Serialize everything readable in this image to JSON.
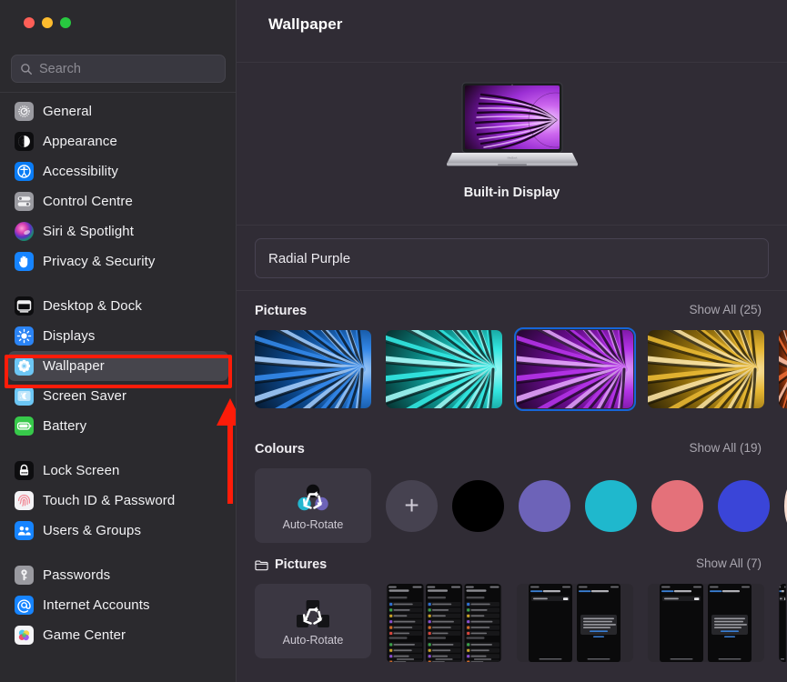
{
  "window": {
    "traffic_lights": [
      {
        "name": "close",
        "color": "#ff5f57"
      },
      {
        "name": "minimise",
        "color": "#febc2e"
      },
      {
        "name": "zoom",
        "color": "#28c840"
      }
    ]
  },
  "search": {
    "placeholder": "Search",
    "value": "",
    "icon": "search-icon"
  },
  "sidebar": {
    "groups": [
      {
        "items": [
          {
            "label": "General",
            "icon": "gear-icon",
            "color": "#8e8e93",
            "selected": false
          },
          {
            "label": "Appearance",
            "icon": "contrast-icon",
            "color": "#1c1c1e",
            "selected": false
          },
          {
            "label": "Accessibility",
            "icon": "accessibility-icon",
            "color": "#0a84ff",
            "selected": false
          },
          {
            "label": "Control Centre",
            "icon": "sliders-icon",
            "color": "#8e8e93",
            "selected": false
          },
          {
            "label": "Siri & Spotlight",
            "icon": "siri-orb-icon",
            "color": "#c44ad0",
            "selected": false
          },
          {
            "label": "Privacy & Security",
            "icon": "hand-icon",
            "color": "#1684ff",
            "selected": false
          }
        ]
      },
      {
        "items": [
          {
            "label": "Desktop & Dock",
            "icon": "desktop-dock-icon",
            "color": "#1c1c1e",
            "selected": false
          },
          {
            "label": "Displays",
            "icon": "brightness-icon",
            "color": "#2b84f5",
            "selected": false
          },
          {
            "label": "Wallpaper",
            "icon": "flower-icon",
            "color": "#6fc7f5",
            "selected": true
          },
          {
            "label": "Screen Saver",
            "icon": "moon-icon",
            "color": "#6fc7f5",
            "selected": false
          },
          {
            "label": "Battery",
            "icon": "battery-icon",
            "color": "#37c94a",
            "selected": false
          }
        ]
      },
      {
        "items": [
          {
            "label": "Lock Screen",
            "icon": "lock-icon",
            "color": "#1c1c1e",
            "selected": false
          },
          {
            "label": "Touch ID & Password",
            "icon": "fingerprint-icon",
            "color": "#f2f2f4",
            "selected": false
          },
          {
            "label": "Users & Groups",
            "icon": "users-icon",
            "color": "#1684ff",
            "selected": false
          }
        ]
      },
      {
        "items": [
          {
            "label": "Passwords",
            "icon": "key-icon",
            "color": "#8e8e93",
            "selected": false
          },
          {
            "label": "Internet Accounts",
            "icon": "at-sign-icon",
            "color": "#1684ff",
            "selected": false
          },
          {
            "label": "Game Center",
            "icon": "game-center-icon",
            "color": "#f5f5f7",
            "selected": false
          }
        ]
      }
    ]
  },
  "main": {
    "title": "Wallpaper",
    "display": {
      "label": "Built-in Display",
      "preview_wallpaper": "Radial Purple"
    },
    "wallpaper_name": {
      "value": "Radial Purple"
    },
    "sections": [
      {
        "id": "pictures",
        "title": "Pictures",
        "has_folder_icon": false,
        "show_all": "Show All (25)",
        "show_all_count": 25,
        "thumbnails": [
          {
            "name": "Radial Blue",
            "hue": 212,
            "selected": false,
            "partial": false
          },
          {
            "name": "Radial Teal",
            "hue": 178,
            "selected": false,
            "partial": false
          },
          {
            "name": "Radial Purple",
            "hue": 283,
            "selected": true,
            "partial": false
          },
          {
            "name": "Radial Yellow",
            "hue": 44,
            "selected": false,
            "partial": false
          },
          {
            "name": "Radial Orange",
            "hue": 18,
            "selected": false,
            "partial": true
          }
        ]
      },
      {
        "id": "colours",
        "title": "Colours",
        "has_folder_icon": false,
        "show_all": "Show All (19)",
        "show_all_count": 19,
        "auto_rotate": {
          "label": "Auto-Rotate",
          "icon": "auto-rotate-icon"
        },
        "swatches": [
          {
            "name": "add-colour",
            "color": "#464250",
            "is_add": true
          },
          {
            "name": "black",
            "color": "#000000",
            "is_add": false
          },
          {
            "name": "purple",
            "color": "#6d63b8",
            "is_add": false
          },
          {
            "name": "cyan",
            "color": "#1fb8cd",
            "is_add": false
          },
          {
            "name": "salmon",
            "color": "#e4717a",
            "is_add": false
          },
          {
            "name": "blue",
            "color": "#3a45d8",
            "is_add": false
          },
          {
            "name": "cream",
            "color": "#f7dcd0",
            "is_add": false
          }
        ]
      },
      {
        "id": "pictures-folder",
        "title": "Pictures",
        "has_folder_icon": true,
        "folder_icon": "folder-icon",
        "show_all": "Show All (7)",
        "show_all_count": 7,
        "auto_rotate": {
          "label": "Auto-Rotate",
          "icon": "auto-rotate-icon"
        },
        "screenshots": [
          {
            "name": "screenshot-settings-list",
            "variant": "list",
            "partial": false
          },
          {
            "name": "screenshot-dark-pair-a",
            "variant": "pair",
            "partial": false
          },
          {
            "name": "screenshot-dark-pair-b",
            "variant": "pair",
            "partial": false
          },
          {
            "name": "screenshot-dark-edge",
            "variant": "edge",
            "partial": true
          }
        ]
      }
    ]
  },
  "annotations": {
    "highlight_box": {
      "name": "wallpaper-highlight-box",
      "color": "#fe1c09"
    },
    "arrow": {
      "name": "pointer-arrow",
      "color": "#fe1c09"
    }
  }
}
